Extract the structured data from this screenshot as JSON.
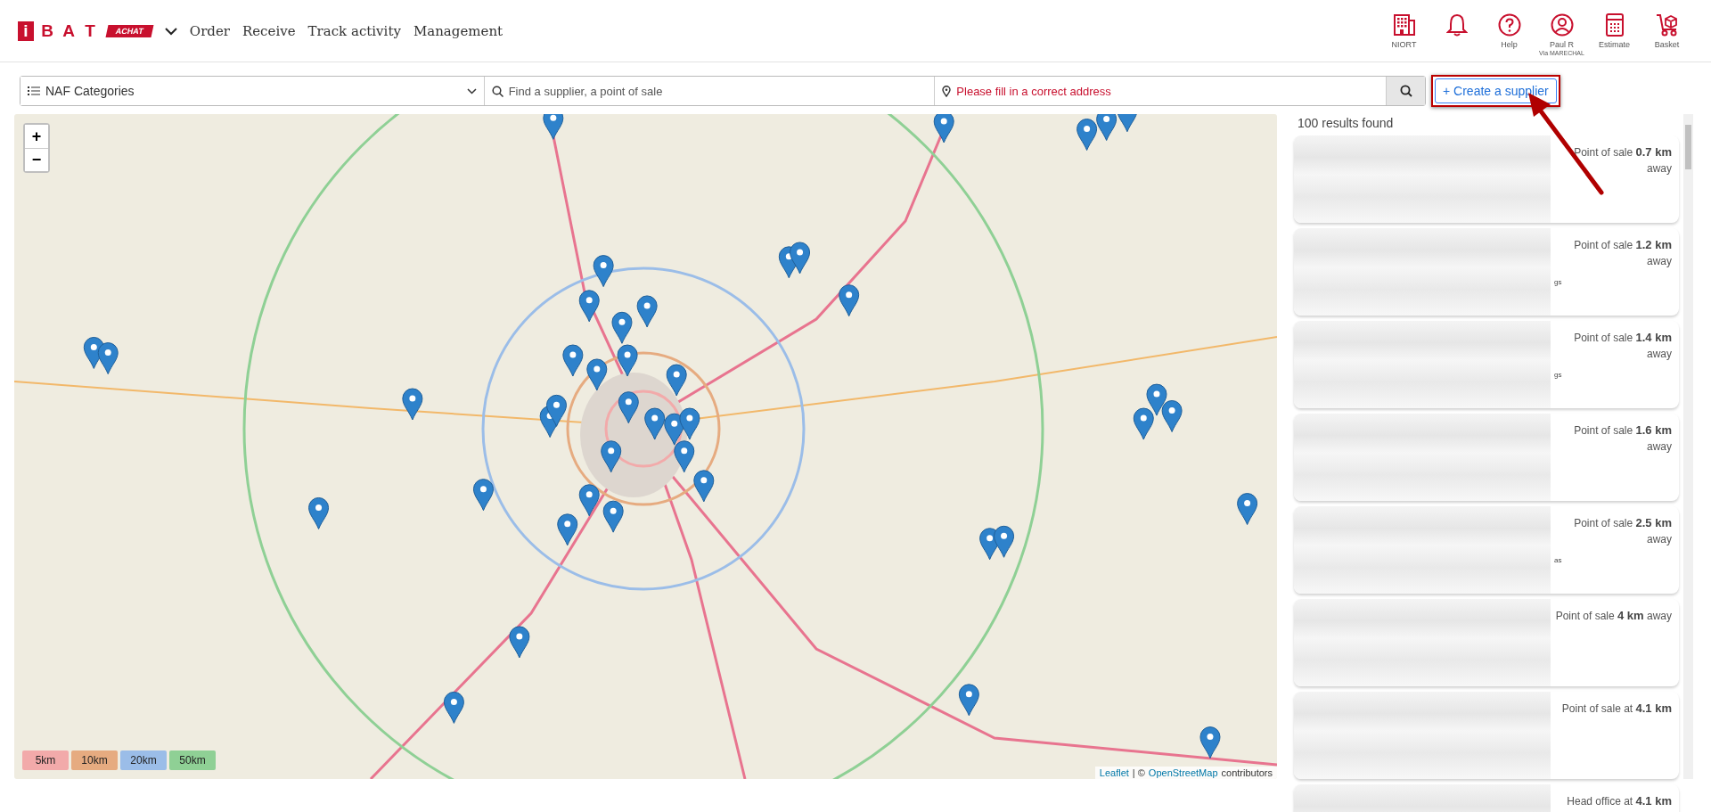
{
  "header": {
    "logo": {
      "letters": [
        "i",
        "B",
        "A",
        "T"
      ],
      "tag": "ACHAT"
    },
    "nav": [
      "Order",
      "Receive",
      "Track activity",
      "Management"
    ],
    "actions": [
      {
        "kind": "store",
        "label": "NIORT"
      },
      {
        "kind": "notifications"
      },
      {
        "kind": "help",
        "label": "Help"
      },
      {
        "kind": "account",
        "label": "Paul R",
        "sublabel": "Via MARECHAL"
      },
      {
        "kind": "estimate",
        "label": "Estimate"
      },
      {
        "kind": "basket",
        "label": "Basket"
      }
    ]
  },
  "search": {
    "category": "NAF Categories",
    "query_placeholder": "Find a supplier, a point of sale",
    "address_placeholder": "Please fill in a correct address",
    "address_invalid": true,
    "create_icon": "+",
    "create_label": "Create a supplier"
  },
  "map": {
    "zoom_in": "+",
    "zoom_out": "−",
    "legend": [
      {
        "label": "5km",
        "color": "#f2aaaa"
      },
      {
        "label": "10km",
        "color": "#e6ab80"
      },
      {
        "label": "20km",
        "color": "#9bbde8"
      },
      {
        "label": "50km",
        "color": "#8fd095"
      }
    ],
    "attribution": {
      "link_1": "Leaflet",
      "separator": "| ©",
      "link_2": "OpenStreetMap",
      "suffix": "contributors"
    }
  },
  "results": {
    "count": "100 results found",
    "cards": [
      {
        "text": "Point of sale **0.7 km** away"
      },
      {
        "text": "Point of sale **1.2 km** away",
        "fragment": "gs"
      },
      {
        "text": "Point of sale **1.4 km** away",
        "fragment": "gs"
      },
      {
        "text": "Point of sale **1.6 km** away"
      },
      {
        "text": "Point of sale **2.5 km** away",
        "fragment": "as"
      },
      {
        "text": "Point of sale **4 km** away"
      },
      {
        "text": "Point of sale at **4.1 km**"
      },
      {
        "text": "Head office at **4.1 km**"
      }
    ]
  }
}
